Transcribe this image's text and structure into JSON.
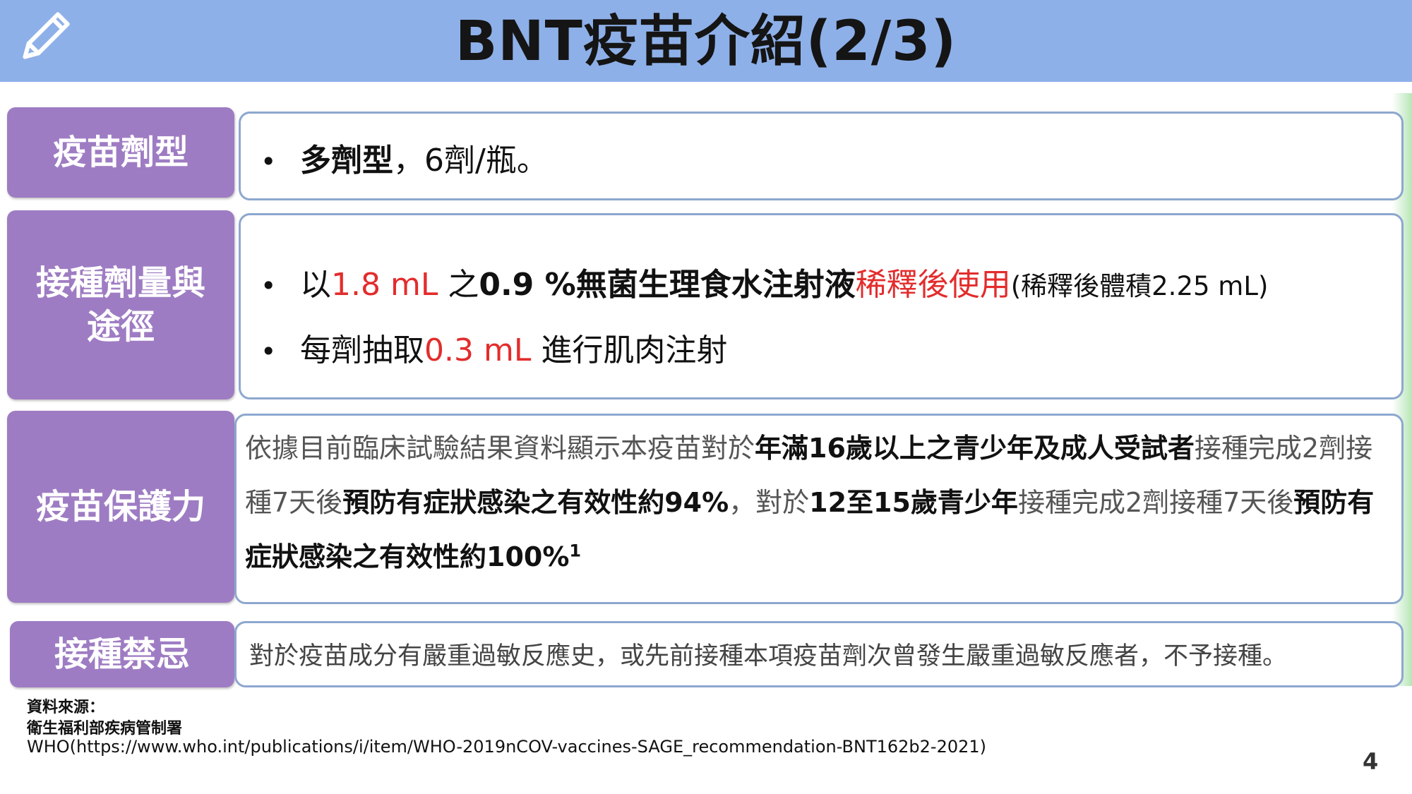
{
  "header": {
    "title": "BNT疫苗介紹(2/3)",
    "icon": "pencil-icon",
    "bg_color": "#8eb0e9"
  },
  "sections": {
    "formulation": {
      "label": "疫苗劑型",
      "bullet": "•",
      "text_bold": "多劑型",
      "text_rest": "，6劑/瓶。"
    },
    "dosage": {
      "label_line1": "接種劑量與",
      "label_line2": "途徑",
      "bullet": "•",
      "line1": {
        "a": "以",
        "b": "1.8 mL",
        "c": " 之",
        "d": "0.9 %無菌生理食水注射液",
        "e": "稀釋後使用",
        "f": "(稀釋後體積2.25 mL)"
      },
      "line2": {
        "a": "每劑抽取",
        "b": "0.3 mL",
        "c": " 進行肌肉注射"
      }
    },
    "efficacy": {
      "label": "疫苗保護力",
      "p1": "依據目前臨床試驗結果資料顯示本疫苗對於",
      "p2": "年滿16歲以上之青少年及成人受試者",
      "p3": "接種完成2劑接種7天後",
      "p4": "預防有症狀感染之有效性約94%",
      "p5": "，對於",
      "p6": "12至15歲青少年",
      "p7": "接種完成2劑接種7天後",
      "p8": "預防有症狀感染之有效性約100%",
      "sup": "1"
    },
    "contraindication": {
      "label": "接種禁忌",
      "text": "對於疫苗成分有嚴重過敏反應史，或先前接種本項疫苗劑次曾發生嚴重過敏反應者，不予接種。"
    }
  },
  "footer": {
    "source_label": "資料來源：",
    "source1": "衛生福利部疾病管制署",
    "source2": "WHO(https://www.who.int/publications/i/item/WHO-2019nCOV-vaccines-SAGE_recommendation-BNT162b2-2021)",
    "page_number": "4"
  },
  "colors": {
    "label_bg": "#9e7cc3",
    "box_border": "#8da7cf",
    "highlight_red": "#e32c2c"
  }
}
